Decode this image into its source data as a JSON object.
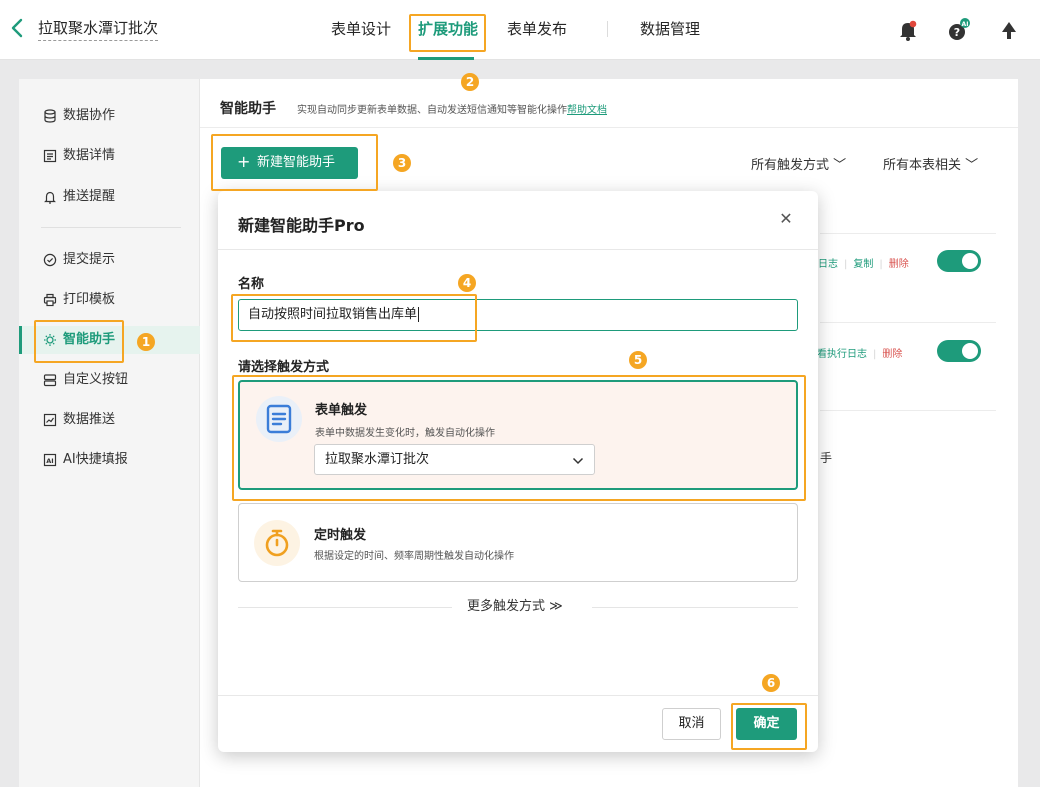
{
  "header": {
    "app_title": "拉取聚水潭订批次",
    "tabs": [
      {
        "label": "表单设计"
      },
      {
        "label": "扩展功能"
      },
      {
        "label": "表单发布"
      },
      {
        "label": "数据管理"
      }
    ],
    "icons": [
      "back-icon",
      "bell-icon",
      "help-icon",
      "upgrade-icon"
    ],
    "help_badge": "AI"
  },
  "sidebar": {
    "items": [
      {
        "label": "数据协作",
        "icon": "database-icon"
      },
      {
        "label": "数据详情",
        "icon": "detail-icon"
      },
      {
        "label": "推送提醒",
        "icon": "bell-icon"
      },
      {
        "label": "提交提示",
        "icon": "check-circle-icon"
      },
      {
        "label": "打印模板",
        "icon": "printer-icon"
      },
      {
        "label": "智能助手",
        "icon": "bulb-icon"
      },
      {
        "label": "自定义按钮",
        "icon": "button-icon"
      },
      {
        "label": "数据推送",
        "icon": "chart-icon"
      },
      {
        "label": "AI快捷填报",
        "icon": "ai-icon"
      }
    ],
    "active_index": 5
  },
  "content": {
    "title": "智能助手",
    "description": "实现自动同步更新表单数据、自动发送短信通知等智能化操作",
    "help_link": "帮助文档",
    "new_button": "新建智能助手",
    "filters": [
      "所有触发方式",
      "所有本表相关"
    ],
    "rows": [
      {
        "actions": [
          "日志",
          "复制",
          "删除"
        ],
        "enabled": true
      },
      {
        "actions": [
          "看执行日志",
          "删除"
        ],
        "enabled": true
      }
    ],
    "partial_text": "手"
  },
  "modal": {
    "title": "新建智能助手Pro",
    "name_label": "名称",
    "name_value": "自动按照时间拉取销售出库单",
    "trigger_label": "请选择触发方式",
    "triggers": [
      {
        "title": "表单触发",
        "desc": "表单中数据发生变化时，触发自动化操作",
        "selected": true,
        "form": "拉取聚水潭订批次",
        "icon": "form-icon"
      },
      {
        "title": "定时触发",
        "desc": "根据设定的时间、频率周期性触发自动化操作",
        "selected": false,
        "icon": "timer-icon"
      }
    ],
    "more": "更多触发方式",
    "cancel": "取消",
    "ok": "确定"
  },
  "annotations": [
    "1",
    "2",
    "3",
    "4",
    "5",
    "6"
  ],
  "colors": {
    "accent": "#1e9b7b",
    "danger": "#d9534f",
    "highlight": "#f5a623"
  }
}
